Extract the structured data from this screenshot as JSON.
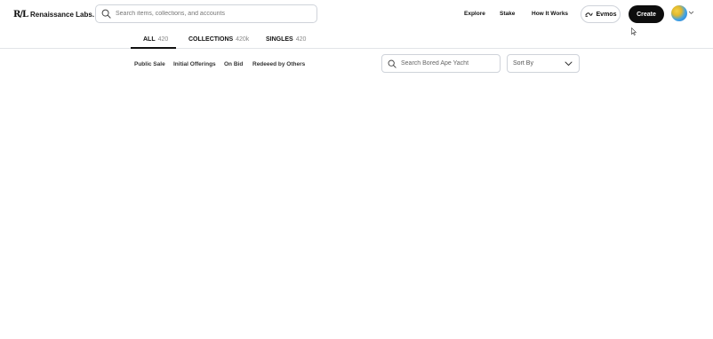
{
  "header": {
    "logo_mark": "R/L",
    "logo_text": "Renaissance Labs.",
    "search_placeholder": "Search items, collections, and accounts",
    "nav": [
      {
        "label": "Explore"
      },
      {
        "label": "Stake"
      },
      {
        "label": "How It Works"
      }
    ],
    "network": {
      "label": "Evmos",
      "icon": "evmos-icon"
    },
    "create_label": "Create",
    "avatar": {
      "icon": "avatar",
      "menu_icon": "chevron-down-icon"
    }
  },
  "tabs": [
    {
      "label": "ALL",
      "count": "420",
      "active": true
    },
    {
      "label": "COLLECTIONS",
      "count": "420k",
      "active": false
    },
    {
      "label": "SINGLES",
      "count": "420",
      "active": false
    }
  ],
  "filters": [
    {
      "label": "Public Sale"
    },
    {
      "label": "Initial Offerings"
    },
    {
      "label": "On Bid"
    },
    {
      "label": "Redeeed by Others"
    }
  ],
  "collection_search": {
    "placeholder": "Search Bored Ape Yacht"
  },
  "sort": {
    "label": "Sort By"
  },
  "colors": {
    "primary": "#0d0d0d",
    "border": "#cfd3da",
    "muted": "#888888"
  }
}
